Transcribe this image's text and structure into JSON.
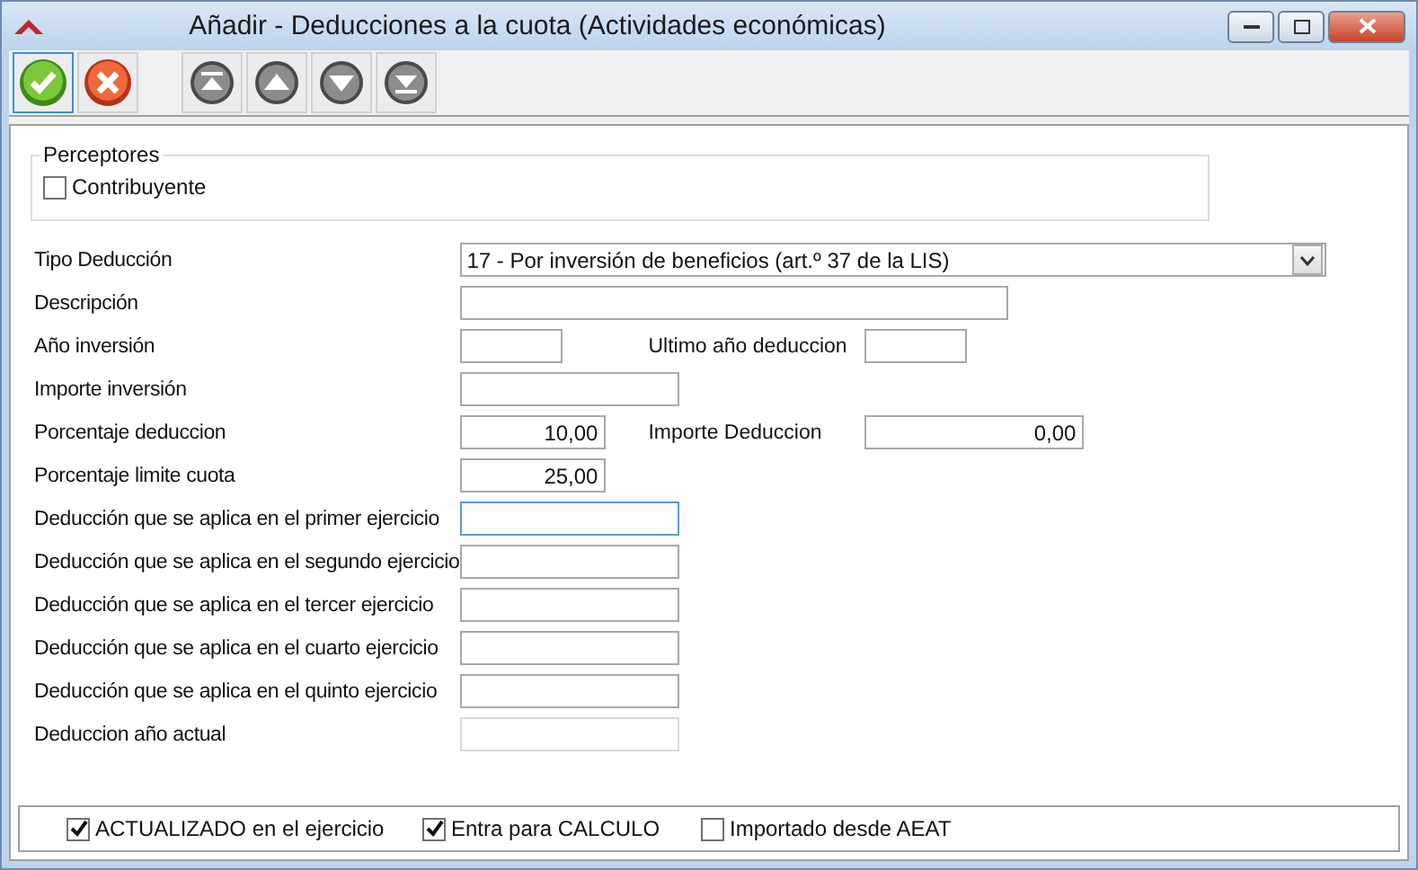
{
  "window": {
    "title": "Añadir  - Deducciones a la cuota (Actividades económicas)"
  },
  "toolbar": [
    {
      "kind": "accept",
      "selected": true
    },
    {
      "kind": "cancel",
      "selected": false
    },
    {
      "kind": "first",
      "selected": false
    },
    {
      "kind": "previous",
      "selected": false
    },
    {
      "kind": "next",
      "selected": false
    },
    {
      "kind": "last",
      "selected": false
    }
  ],
  "perceptores": {
    "title": "Perceptores",
    "items": [
      {
        "label": "Contribuyente",
        "checked": false
      }
    ]
  },
  "form": [
    {
      "label": "Tipo Deducción",
      "field": {
        "kind": "combo",
        "value": "17 - Por inversión de beneficios (art.º 37 de la LIS)",
        "focused": false,
        "disabled": false
      }
    },
    {
      "label": "Descripción",
      "field": {
        "kind": "wide",
        "focused": false,
        "disabled": false
      }
    },
    {
      "label": "Año inversión",
      "field": {
        "kind": "short",
        "focused": false,
        "disabled": false
      },
      "extra": {
        "label": "Ultimo año deduccion",
        "field": {
          "kind": "short",
          "focused": false,
          "disabled": false
        }
      }
    },
    {
      "label": "Importe inversión",
      "field": {
        "kind": "medium",
        "focused": false,
        "disabled": false
      }
    },
    {
      "label": "Porcentaje deduccion",
      "field": {
        "kind": "number",
        "value": "10,00",
        "focused": false,
        "disabled": false
      },
      "extra": {
        "label": "Importe Deduccion",
        "field": {
          "kind": "medium",
          "value": "0,00",
          "focused": false,
          "disabled": false
        }
      }
    },
    {
      "label": "Porcentaje limite cuota",
      "field": {
        "kind": "number",
        "value": "25,00",
        "focused": false,
        "disabled": false
      }
    },
    {
      "label": "Deducción que se aplica en el primer ejercicio",
      "field": {
        "kind": "medium",
        "focused": true,
        "disabled": false
      }
    },
    {
      "label": "Deducción que se aplica en el segundo ejercicio",
      "field": {
        "kind": "medium",
        "focused": false,
        "disabled": false
      }
    },
    {
      "label": "Deducción que se aplica en el tercer ejercicio",
      "field": {
        "kind": "medium",
        "focused": false,
        "disabled": false
      }
    },
    {
      "label": "Deducción que se aplica en el cuarto ejercicio",
      "field": {
        "kind": "medium",
        "focused": false,
        "disabled": false
      }
    },
    {
      "label": "Deducción que se aplica en el quinto ejercicio",
      "field": {
        "kind": "medium",
        "focused": false,
        "disabled": false
      }
    },
    {
      "label": "Deduccion año actual",
      "field": {
        "kind": "medium",
        "focused": false,
        "disabled": true
      }
    }
  ],
  "footer": [
    {
      "label": "ACTUALIZADO en el ejercicio",
      "checked": true
    },
    {
      "label": "Entra para CALCULO",
      "checked": true
    },
    {
      "label": "Importado desde AEAT",
      "checked": false
    }
  ]
}
